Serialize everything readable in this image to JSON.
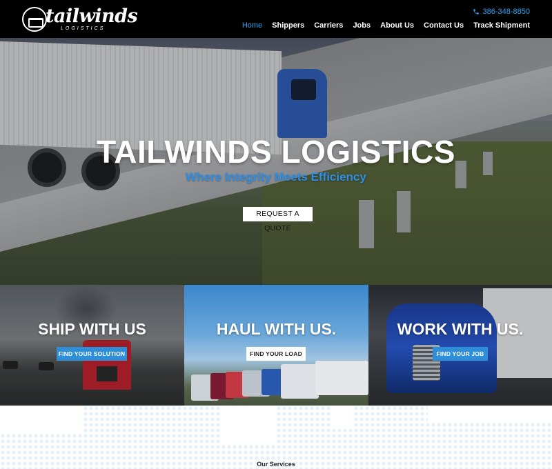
{
  "header": {
    "logo_text": "tailwinds",
    "logo_subtext": "LOGISTICS",
    "phone": "386-348-8850",
    "phone_icon": "phone-icon",
    "nav": [
      {
        "label": "Home",
        "active": true
      },
      {
        "label": "Shippers",
        "active": false
      },
      {
        "label": "Carriers",
        "active": false
      },
      {
        "label": "Jobs",
        "active": false
      },
      {
        "label": "About Us",
        "active": false
      },
      {
        "label": "Contact Us",
        "active": false
      },
      {
        "label": "Track Shipment",
        "active": false
      }
    ]
  },
  "hero": {
    "title": "TAILWINDS LOGISTICS",
    "subtitle": "Where Integrity Meets Efficiency",
    "cta": "REQUEST A QUOTE"
  },
  "panels": [
    {
      "title": "SHIP WITH US",
      "button": "FIND YOUR SOLUTION",
      "button_style": "blue"
    },
    {
      "title": "HAUL WITH US.",
      "button": "FIND YOUR LOAD",
      "button_style": "white"
    },
    {
      "title": "WORK WITH US.",
      "button": "FIND YOUR JOB",
      "button_style": "blue"
    }
  ],
  "services": {
    "title": "Our Services"
  },
  "colors": {
    "accent": "#2ea3f2",
    "button_blue": "#2e8fd8",
    "header_bg": "#000000"
  }
}
